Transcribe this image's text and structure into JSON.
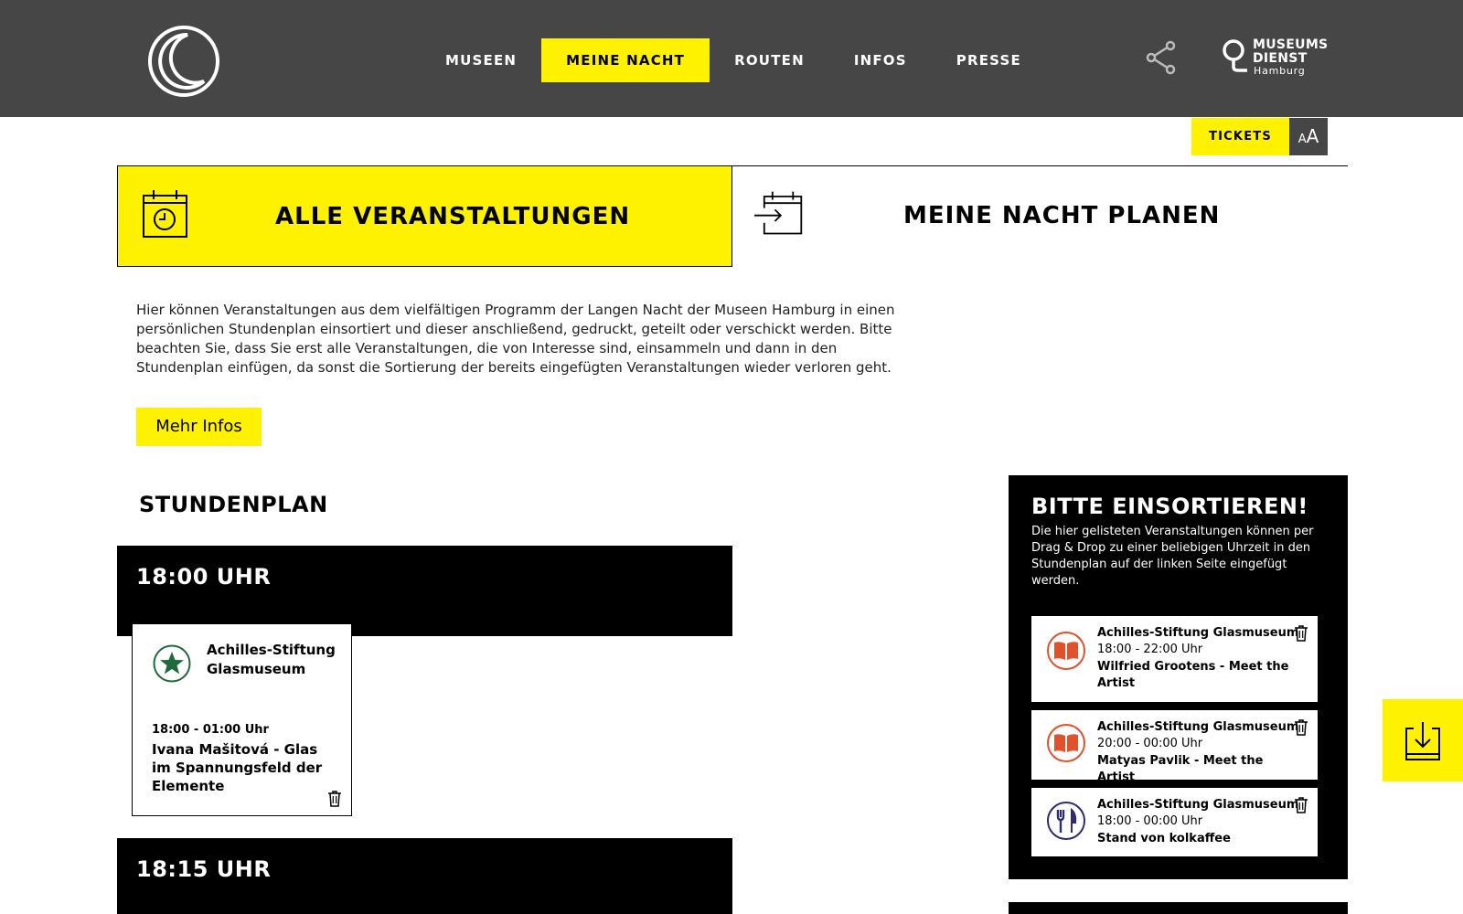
{
  "nav": {
    "items": [
      {
        "label": "MUSEEN"
      },
      {
        "label": "MEINE NACHT"
      },
      {
        "label": "ROUTEN"
      },
      {
        "label": "INFOS"
      },
      {
        "label": "PRESSE"
      }
    ],
    "active_index": 1
  },
  "brand": {
    "logo_line1": "MUSEUMS",
    "logo_line2": "DIENST",
    "logo_line3": "Hamburg"
  },
  "toolbar": {
    "tickets_label": "TICKETS",
    "fontsize_small": "A",
    "fontsize_large": "A"
  },
  "tabs": {
    "all_label": "ALLE VERANSTALTUNGEN",
    "plan_label": "MEINE NACHT PLANEN"
  },
  "intro": {
    "text": "Hier können Veranstaltungen aus dem vielfältigen Programm der Langen Nacht der Museen Hamburg in einen persönlichen Stundenplan einsortiert und dieser anschließend, gedruckt, geteilt oder verschickt werden. Bitte beachten Sie, dass Sie erst alle Veranstaltungen, die von Interesse sind, einsammeln und dann in den Stundenplan einfügen, da sonst die Sortierung der bereits eingefügten Veranstaltungen wieder verloren geht.",
    "more_label": "Mehr Infos"
  },
  "schedule": {
    "title": "STUNDENPLAN",
    "slots": [
      {
        "label": "18:00 UHR"
      },
      {
        "label": "18:15 UHR"
      }
    ],
    "event": {
      "museum": "Achilles-Stiftung Glasmuseum",
      "time": "18:00 - 01:00 Uhr",
      "name": "Ivana Mašitová - Glas im Spannungsfeld der Elemente"
    }
  },
  "sort_panel": {
    "title": "BITTE EINSORTIEREN!",
    "description": "Die hier gelisteten Veranstaltungen können per Drag & Drop zu einer beliebigen Uhrzeit in den Stundenplan auf der linken Seite eingefügt werden.",
    "items": [
      {
        "museum": "Achilles-Stiftung Glasmuseum",
        "time": "18:00 - 22:00 Uhr",
        "name": "Wilfried Grootens - Meet the Artist",
        "icon": "book-icon"
      },
      {
        "museum": "Achilles-Stiftung Glasmuseum",
        "time": "20:00 - 00:00 Uhr",
        "name": "Matyas Pavlik - Meet the Artist",
        "icon": "book-icon"
      },
      {
        "museum": "Achilles-Stiftung Glasmuseum",
        "time": "18:00 - 00:00 Uhr",
        "name": "Stand von kolkaffee",
        "icon": "fork-knife-icon"
      }
    ]
  },
  "colors": {
    "header_bg": "#464646",
    "accent": "#fff200",
    "star_green": "#1e6a3c",
    "book_orange": "#e0522b",
    "food_navy": "#2c2c6e"
  }
}
